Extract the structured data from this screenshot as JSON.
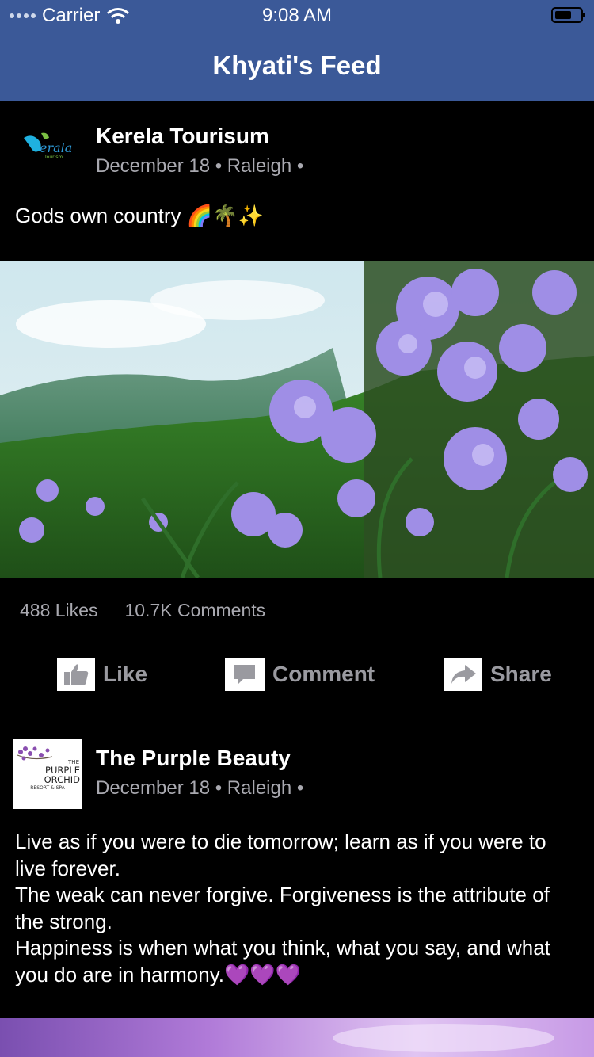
{
  "status_bar": {
    "carrier": "Carrier",
    "time": "9:08 AM"
  },
  "nav": {
    "title": "Khyati's Feed"
  },
  "posts": [
    {
      "author": "Kerela Tourisum",
      "meta": "December 18 • Raleigh •",
      "text": "Gods own country 🌈🌴✨",
      "avatar_text": "Kerala Tourism",
      "likes": "488 Likes",
      "comments": "10.7K Comments"
    },
    {
      "author": "The Purple Beauty",
      "meta": "December 18 • Raleigh •",
      "text": "Live as if you were to die tomorrow; learn as if you were to live forever.\nThe weak can never forgive. Forgiveness is the attribute of the strong.\nHappiness is when what you think, what you say, and what you do are in harmony.💜💜💜",
      "avatar_text": {
        "line1": "THE",
        "line2": "PURPLE",
        "line3": "ORCHID",
        "line4": "RESORT & SPA"
      }
    }
  ],
  "actions": {
    "like": "Like",
    "comment": "Comment",
    "share": "Share"
  },
  "colors": {
    "nav_bar": "#3b5998",
    "background": "#000000",
    "meta_text": "#a9a9b0",
    "action_text": "#9a9aa0"
  },
  "icons": [
    "wifi-icon",
    "battery-icon",
    "like-icon",
    "comment-icon",
    "share-icon"
  ]
}
